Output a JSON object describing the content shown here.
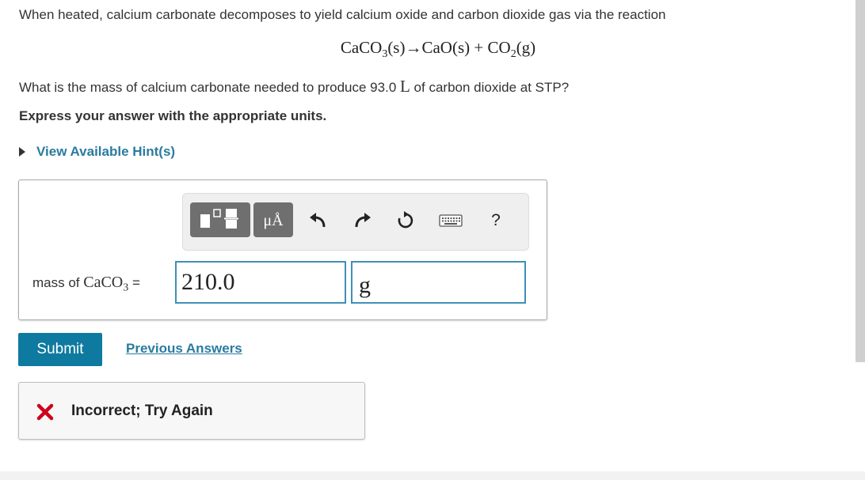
{
  "problem": {
    "intro": "When heated, calcium carbonate decomposes to yield calcium oxide and carbon dioxide gas via the reaction",
    "equation": {
      "reactant": "CaCO",
      "reactant_sub": "3",
      "reactant_state": "(s)",
      "arrow": "→",
      "product1": "CaO",
      "product1_state": "(s)",
      "plus": "+",
      "product2": "CO",
      "product2_sub": "2",
      "product2_state": "(g)"
    },
    "question_before": "What is the mass of calcium carbonate needed to produce 93.0 ",
    "question_unit": "L",
    "question_after": " of carbon dioxide at STP?",
    "instruction": "Express your answer with the appropriate units.",
    "hint_link": "View Available Hint(s)"
  },
  "answer": {
    "toolbar": {
      "templates_icon": "templates-icon",
      "units_label": "μÅ",
      "undo_icon": "undo-icon",
      "redo_icon": "redo-icon",
      "reset_icon": "reset-icon",
      "keyboard_icon": "keyboard-icon",
      "help_label": "?"
    },
    "label_prefix": "mass of ",
    "label_chem": "CaCO",
    "label_sub": "3",
    "label_suffix": " =",
    "value": "210.0",
    "unit": "g"
  },
  "actions": {
    "submit_label": "Submit",
    "previous_answers_label": "Previous Answers"
  },
  "feedback": {
    "icon": "incorrect-x-icon",
    "message": "Incorrect; Try Again",
    "color": "#d0021b"
  },
  "colors": {
    "link": "#2a7ba0",
    "submit_bg": "#0e7aa0",
    "input_border": "#3f90b6"
  }
}
